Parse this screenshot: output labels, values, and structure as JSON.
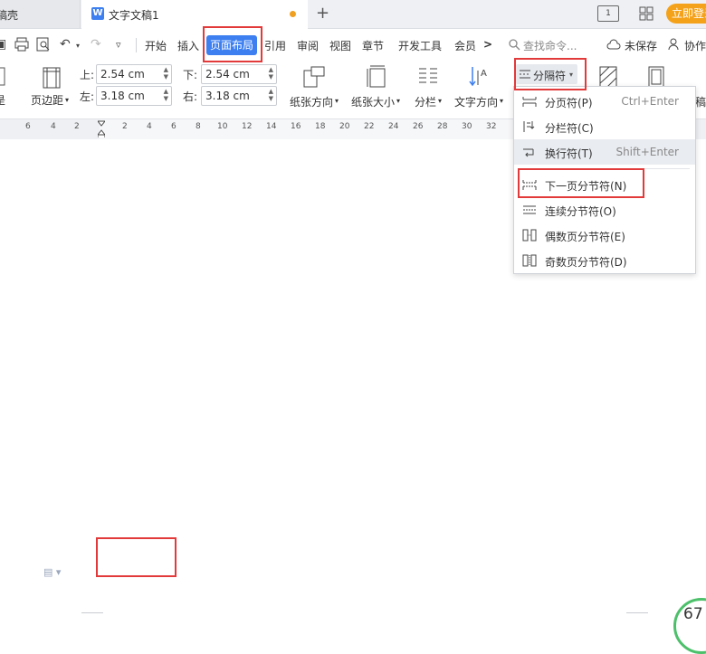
{
  "tabs": {
    "left_label": "稿壳",
    "active_logo": "W",
    "active_title": "文字文稿1",
    "icons": [
      "page-layout-icon",
      "grid-icon",
      "plus-icon"
    ],
    "login_label": "立即登录",
    "layout_icon_text": "1"
  },
  "toolbar": {
    "quick_icons": [
      "save-icon",
      "print-icon",
      "print-preview-icon",
      "undo-icon",
      "redo-icon",
      "more-icon"
    ]
  },
  "menu": {
    "items": [
      "开始",
      "插入",
      "页面布局",
      "引用",
      "审阅",
      "视图",
      "章节",
      "开发工具",
      "会员"
    ],
    "active_label": "页面布局",
    "more_glyph": ">",
    "search_placeholder": "查找命令...",
    "unsaved_label": "未保存",
    "collab_label": "协作"
  },
  "ribbon": {
    "partial_left_label": "是",
    "margins_label": "页边距",
    "top_label": "上:",
    "top_value": "2.54 cm",
    "bottom_label": "下:",
    "bottom_value": "2.54 cm",
    "left_label": "左:",
    "left_value": "3.18 cm",
    "right_label": "右:",
    "right_value": "3.18 cm",
    "orientation_label": "纸张方向",
    "size_label": "纸张大小",
    "columns_label": "分栏",
    "text_direction_label": "文字方向",
    "breaks_label": "分隔符",
    "partial_right_label": "稿"
  },
  "ruler": {
    "ticks": [
      "6",
      "4",
      "2",
      "2",
      "4",
      "6",
      "8",
      "10",
      "12",
      "14",
      "16",
      "18",
      "20",
      "22",
      "24",
      "26",
      "28",
      "30",
      "32"
    ]
  },
  "breaks_menu": {
    "items": [
      {
        "label": "分页符(P)",
        "shortcut": "Ctrl+Enter",
        "icon": "page-break-icon"
      },
      {
        "label": "分栏符(C)",
        "shortcut": "",
        "icon": "column-break-icon"
      },
      {
        "label": "换行符(T)",
        "shortcut": "Shift+Enter",
        "icon": "line-break-icon"
      },
      {
        "label": "下一页分节符(N)",
        "shortcut": "",
        "icon": "next-page-section-icon"
      },
      {
        "label": "连续分节符(O)",
        "shortcut": "",
        "icon": "continuous-section-icon"
      },
      {
        "label": "偶数页分节符(E)",
        "shortcut": "",
        "icon": "even-page-section-icon"
      },
      {
        "label": "奇数页分节符(D)",
        "shortcut": "",
        "icon": "odd-page-section-icon"
      }
    ]
  },
  "status": {
    "zoom_text": "67"
  },
  "colors": {
    "accent": "#3d7ff0",
    "highlight_box": "#e23a3a",
    "login_button": "#f5a21b",
    "zoom_ring": "#4cc06a"
  }
}
